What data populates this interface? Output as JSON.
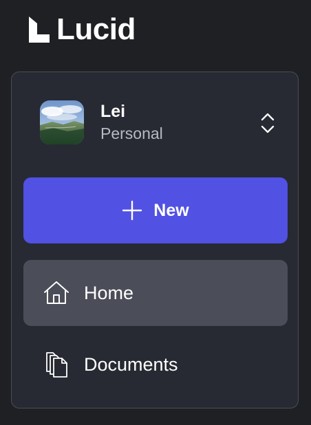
{
  "brand": {
    "name": "Lucid",
    "logo_icon": "lucid-logo-icon"
  },
  "account": {
    "name": "Lei",
    "subtitle": "Personal",
    "avatar_icon": "landscape-avatar-image",
    "switcher_icon": "chevron-up-down-icon"
  },
  "actions": {
    "new_label": "New",
    "new_icon": "plus-icon",
    "new_color": "#5151E3"
  },
  "nav": {
    "items": [
      {
        "label": "Home",
        "icon": "home-icon",
        "active": true
      },
      {
        "label": "Documents",
        "icon": "documents-icon",
        "active": false
      }
    ]
  },
  "theme": {
    "background": "#1F2024",
    "panel_background": "#272A33",
    "active_item_background": "#4B4E58",
    "muted_text": "#B7BAC3"
  }
}
